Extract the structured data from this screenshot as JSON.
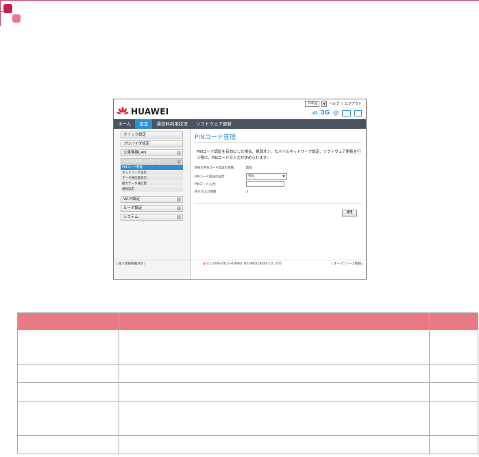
{
  "router_ui": {
    "brand": "HUAWEI",
    "language": "日本語",
    "help": "ヘルプ",
    "logout": "ログアウト",
    "status_3g": "3G",
    "nav": [
      "ホーム",
      "設定",
      "通信料利用状況",
      "ソフトウェア更新"
    ],
    "active_nav": 1,
    "sidebar": {
      "quick": "クイック設定",
      "profile": "プロバイダ設定",
      "wlan": "公衆無線LAN",
      "mobile": "モバイルネットワーク",
      "subs": [
        "PINコード管理",
        "ネットワーク設定",
        "データ通信量表示",
        "最大データ通信量",
        "通知設定"
      ],
      "wifi": "Wi-Fi設定",
      "router": "ルータ設定",
      "system": "システム"
    },
    "page_title": "PINコード管理",
    "description": "PINコード認証を有効にした場合、電源オン、モバイルネットワーク設定、ソフトウェア更新を行う際に、PINコードの入力が求められます。",
    "fields": {
      "state_label": "現在のPINコード認証の状態:",
      "state_value": "無効",
      "op_label": "PINコード認証の設定:",
      "op_value": "有効",
      "input_label": "PINコード入力:",
      "remain_label": "残りの入力回数:",
      "remain_value": "3"
    },
    "apply": "適用",
    "footer_left": "| 個人情報保護方針 |",
    "footer_center": "(C) 2006-2015 HUAWEI TECHNOLOGIES CO., LTD.",
    "footer_right": "| オープンソース情報 |"
  },
  "table": {
    "headers": [
      "",
      "",
      ""
    ],
    "rows": [
      [
        "",
        "",
        ""
      ],
      [
        "",
        "",
        ""
      ],
      [
        "",
        "",
        ""
      ],
      [
        "",
        "",
        ""
      ],
      [
        "",
        "",
        ""
      ]
    ]
  }
}
